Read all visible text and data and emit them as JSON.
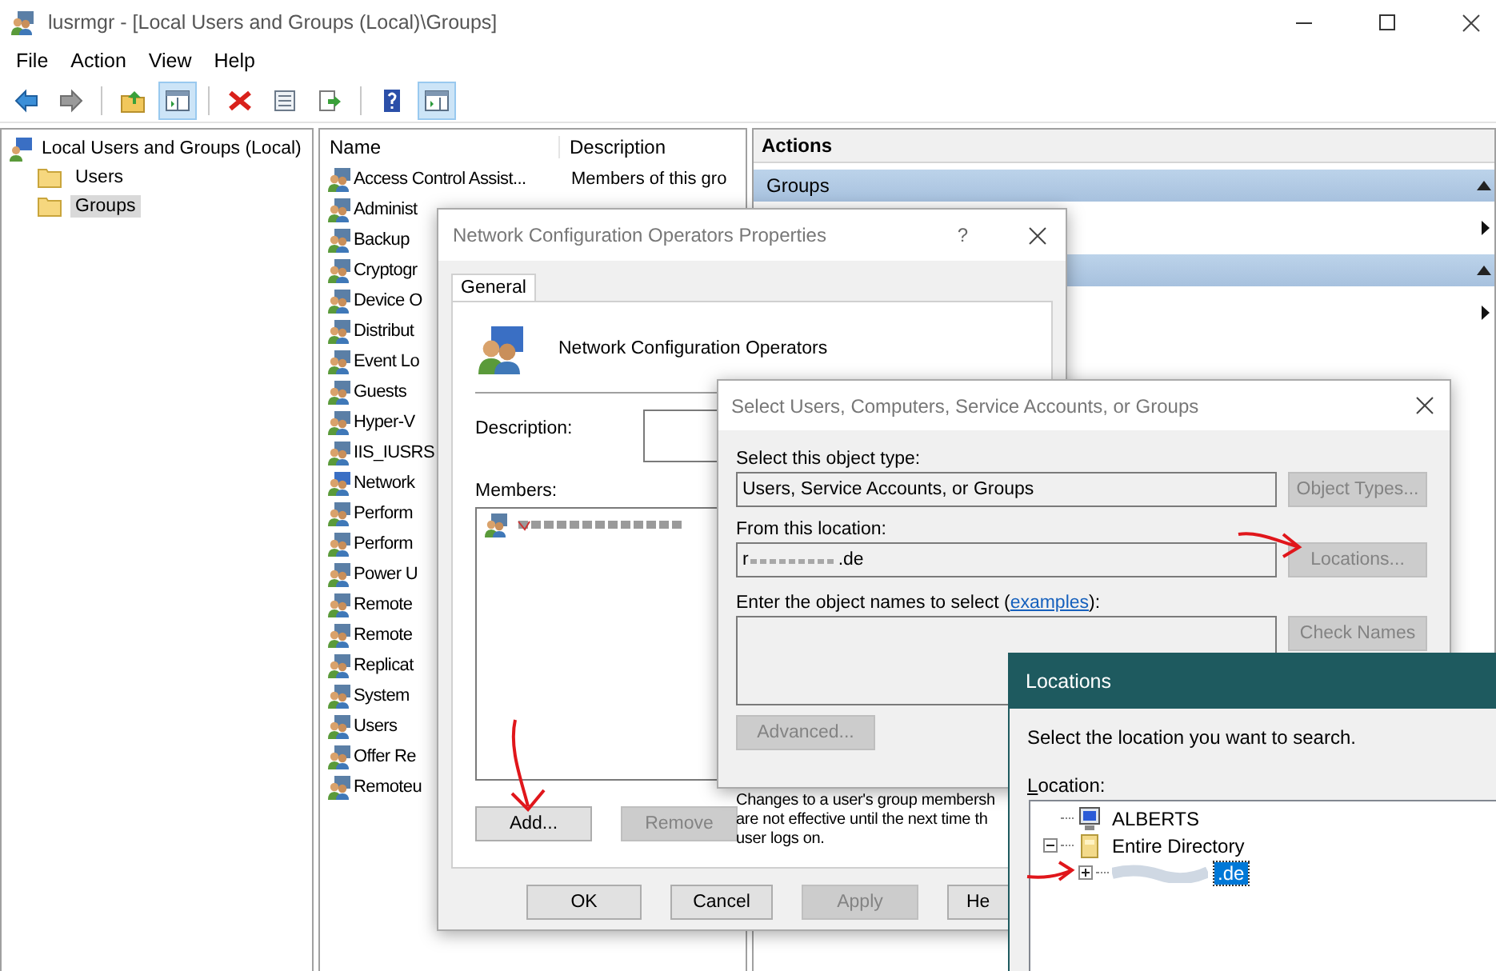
{
  "window": {
    "title": "lusrmgr - [Local Users and Groups (Local)\\Groups]"
  },
  "menu": [
    {
      "label": "File"
    },
    {
      "label": "Action"
    },
    {
      "label": "View"
    },
    {
      "label": "Help"
    }
  ],
  "toolbar": [
    [
      {
        "kind": "back",
        "selected": false
      },
      {
        "kind": "forward",
        "selected": false
      }
    ],
    [
      {
        "kind": "up",
        "selected": false
      },
      {
        "kind": "tree",
        "selected": true
      }
    ],
    [
      {
        "kind": "delete",
        "selected": false
      },
      {
        "kind": "properties",
        "selected": false
      },
      {
        "kind": "export",
        "selected": false
      }
    ],
    [
      {
        "kind": "help",
        "selected": false
      },
      {
        "kind": "actions",
        "selected": true
      }
    ]
  ],
  "tree": {
    "label": "Local Users and Groups (Local)",
    "children": [
      {
        "label": "Users",
        "selected": false
      },
      {
        "label": "Groups",
        "selected": true
      }
    ]
  },
  "list": {
    "columns": [
      "Name",
      "Description"
    ],
    "rows": [
      {
        "name": "Access Control Assist...",
        "description": "Members of this gro"
      },
      {
        "name": "Administ"
      },
      {
        "name": "Backup"
      },
      {
        "name": "Cryptogr"
      },
      {
        "name": "Device O"
      },
      {
        "name": "Distribut"
      },
      {
        "name": "Event Lo"
      },
      {
        "name": "Guests"
      },
      {
        "name": "Hyper-V"
      },
      {
        "name": "IIS_IUSRS"
      },
      {
        "name": "Network"
      },
      {
        "name": "Perform"
      },
      {
        "name": "Perform"
      },
      {
        "name": "Power U"
      },
      {
        "name": "Remote"
      },
      {
        "name": "Remote"
      },
      {
        "name": "Replicat"
      },
      {
        "name": "System"
      },
      {
        "name": "Users"
      },
      {
        "name": "Offer Re"
      },
      {
        "name": "Remoteu"
      }
    ]
  },
  "actions": {
    "title": "Actions",
    "sections": [
      {
        "label": "Groups",
        "expanded": true
      },
      {
        "expanded": true
      }
    ]
  },
  "properties_dialog": {
    "title": "Network Configuration Operators Properties",
    "help": "?",
    "tabs": [
      {
        "label": "General",
        "selected": true
      }
    ],
    "group_name": "Network Configuration Operators",
    "description_label": "Description:",
    "members_label": "Members:",
    "members": [
      {
        "kind": "redacted"
      }
    ],
    "add_button": {
      "label": "Add...",
      "disabled": false
    },
    "remove_button": {
      "label": "Remove",
      "disabled": true
    },
    "note": [
      "Changes to a user's group membersh",
      "are not effective until the next time th",
      "user logs on."
    ],
    "buttons": [
      {
        "label": "OK",
        "disabled": false
      },
      {
        "label": "Cancel",
        "disabled": false
      },
      {
        "label": "Apply",
        "disabled": true
      },
      {
        "label": "He",
        "disabled": false
      }
    ]
  },
  "select_dialog": {
    "title": "Select Users, Computers, Service Accounts, or Groups",
    "object_type_label": "Select this object type:",
    "object_type": "Users, Service Accounts, or Groups",
    "object_types_button": {
      "label": "Object Types...",
      "disabled": true
    },
    "location_label": "From this location:",
    "location_start": "r",
    "location_end": ".de",
    "locations_button": {
      "label": "Locations...",
      "disabled": true
    },
    "names_label_before": "Enter the object names to select (",
    "names_link": "examples",
    "names_label_after": "):",
    "check_names_button": {
      "label": "Check Names",
      "disabled": true
    },
    "advanced_button": {
      "label": "Advanced...",
      "disabled": true
    }
  },
  "locations_dialog": {
    "title": "Locations",
    "prompt": "Select the location you want to search.",
    "location_label": "Location:",
    "tree": [
      {
        "label": "ALBERTS",
        "kind": "computer",
        "selected": false
      },
      {
        "label": "Entire Directory",
        "kind": "directory",
        "selected": false,
        "expanded": true,
        "children": [
          {
            "label": ".de",
            "kind": "domain",
            "selected": true,
            "expanded": false
          }
        ]
      }
    ]
  }
}
